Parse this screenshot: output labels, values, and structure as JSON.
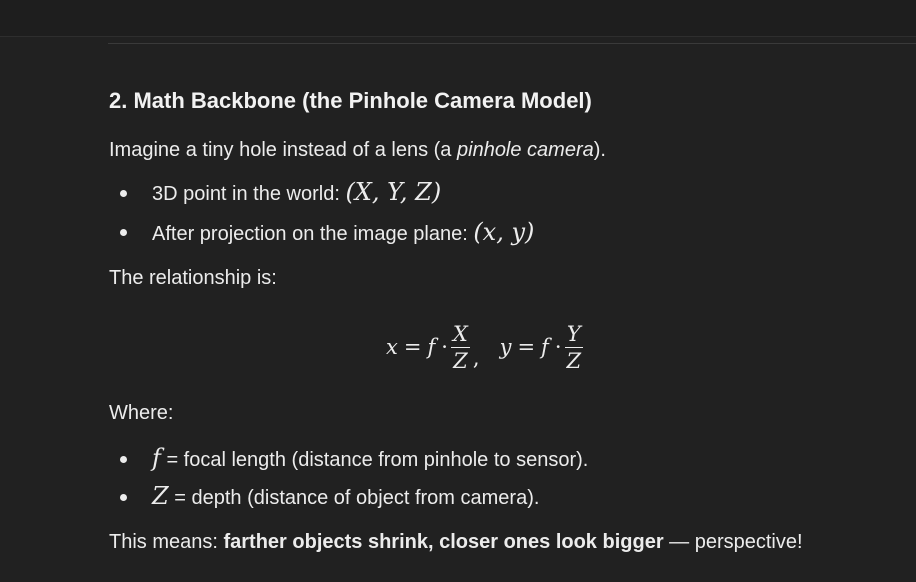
{
  "section": {
    "heading": "2. Math Backbone (the Pinhole Camera Model)",
    "intro": {
      "prefix": "Imagine a tiny hole instead of a lens (a ",
      "emphasis": "pinhole camera",
      "suffix": ")."
    },
    "points": [
      {
        "label": "3D point in the world: ",
        "math": "(X, Y, Z)"
      },
      {
        "label": "After projection on the image plane: ",
        "math": "(x, y)"
      }
    ],
    "relationship_label": "The relationship is:",
    "equation": {
      "lhs1": "x",
      "eq1": "=",
      "f1": "f",
      "dot1": "·",
      "num1": "X",
      "den1": "Z",
      "sep": ",",
      "lhs2": "y",
      "eq2": "=",
      "f2": "f",
      "dot2": "·",
      "num2": "Y",
      "den2": "Z"
    },
    "where_label": "Where:",
    "definitions": [
      {
        "symbol": "f",
        "text": " = focal length (distance from pinhole to sensor)."
      },
      {
        "symbol": "Z",
        "text": " = depth (distance of object from camera)."
      }
    ],
    "conclusion": {
      "prefix": "This means: ",
      "bold": "farther objects shrink, closer ones look bigger",
      "suffix": " — perspective!"
    }
  }
}
